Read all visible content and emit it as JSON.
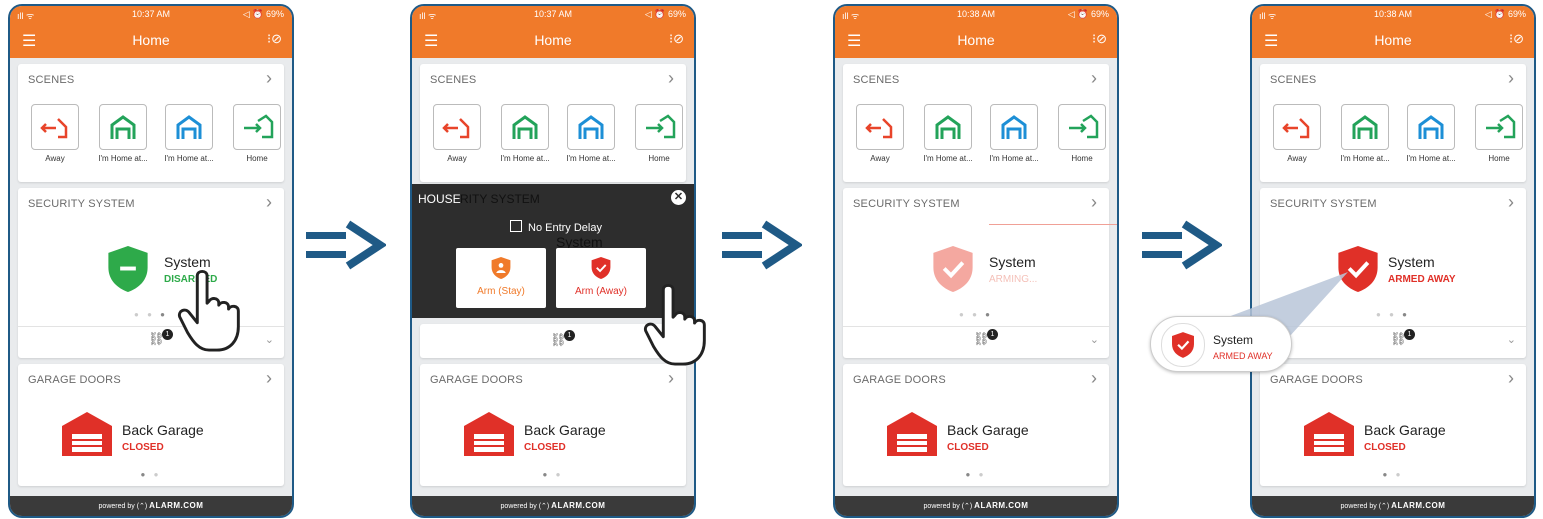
{
  "status_bar": {
    "signal": "ıll ᯤ",
    "battery": "◁ ⏰ 69%",
    "times": [
      "10:37 AM",
      "10:37 AM",
      "10:38 AM",
      "10:38 AM"
    ]
  },
  "nav": {
    "title": "Home",
    "menu_icon": "hamburger-icon",
    "check_icon": "checklist-icon"
  },
  "scenes": {
    "header": "SCENES",
    "items": [
      {
        "label": "Away",
        "icon": "exit-house-icon",
        "color": "#e8442a"
      },
      {
        "label": "I'm Home at...",
        "icon": "garage-icon",
        "color": "#23a35a"
      },
      {
        "label": "I'm Home at...",
        "icon": "garage-icon",
        "color": "#1d8fd6"
      },
      {
        "label": "Home",
        "icon": "enter-house-icon",
        "color": "#23a35a"
      }
    ]
  },
  "security": {
    "header": "SECURITY SYSTEM",
    "name": "System",
    "states": {
      "disarmed": {
        "text": "DISARMED",
        "color": "#2eaa4a"
      },
      "arming": {
        "text": "ARMING...",
        "color": "#f4b0a8"
      },
      "armed_away": {
        "text": "ARMED AWAY",
        "color": "#e03028"
      }
    },
    "badge": "1"
  },
  "arm_overlay": {
    "title": "HOUSE",
    "ghost_header": "RITY SYSTEM",
    "no_entry_delay": "No Entry Delay",
    "ghost_name": "System",
    "arm_stay": "Arm (Stay)",
    "arm_away": "Arm (Away)",
    "close_glyph": "✕"
  },
  "garage": {
    "header": "GARAGE DOORS",
    "name": "Back Garage",
    "status": "CLOSED"
  },
  "footer": {
    "powered": "powered by",
    "brand": "ALARM.COM"
  },
  "callout": {
    "name": "System",
    "status": "ARMED AWAY"
  },
  "colors": {
    "accent": "#f07a2a",
    "frame": "#1f5a86",
    "arrow": "#1f5a86",
    "armed": "#e03028",
    "disarmed": "#2eaa4a"
  }
}
